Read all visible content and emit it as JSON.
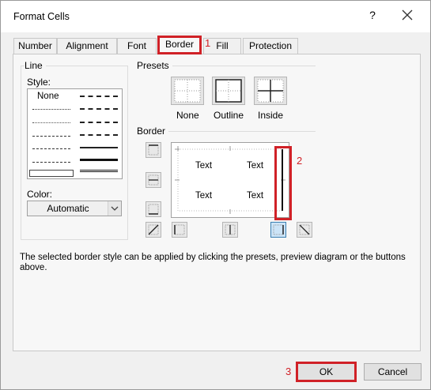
{
  "window": {
    "title": "Format Cells",
    "help_label": "?"
  },
  "tabs": [
    {
      "label": "Number"
    },
    {
      "label": "Alignment"
    },
    {
      "label": "Font"
    },
    {
      "label": "Border",
      "active": true
    },
    {
      "label": "Fill"
    },
    {
      "label": "Protection"
    }
  ],
  "line_group": {
    "title": "Line",
    "style_label": "Style:",
    "style_none": "None",
    "color_label": "Color:",
    "color_value": "Automatic"
  },
  "presets": {
    "title": "Presets",
    "items": [
      {
        "label": "None"
      },
      {
        "label": "Outline"
      },
      {
        "label": "Inside"
      }
    ]
  },
  "border_group": {
    "title": "Border",
    "preview_texts": [
      "Text",
      "Text",
      "Text",
      "Text"
    ]
  },
  "hint_text": "The selected border style can be applied by clicking the presets, preview diagram or the buttons above.",
  "buttons": {
    "ok": "OK",
    "cancel": "Cancel"
  },
  "annotations": [
    "1",
    "2",
    "3"
  ],
  "colors": {
    "annotation": "#d02127",
    "dialog_bg": "#f0f0f0"
  }
}
